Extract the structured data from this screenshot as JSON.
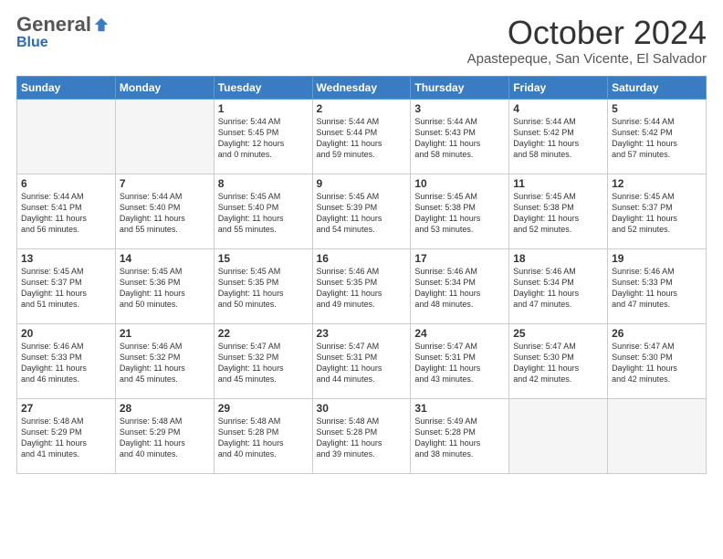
{
  "header": {
    "logo_general": "General",
    "logo_blue": "Blue",
    "month_title": "October 2024",
    "location": "Apastepeque, San Vicente, El Salvador"
  },
  "days_of_week": [
    "Sunday",
    "Monday",
    "Tuesday",
    "Wednesday",
    "Thursday",
    "Friday",
    "Saturday"
  ],
  "weeks": [
    [
      {
        "day": "",
        "info": ""
      },
      {
        "day": "",
        "info": ""
      },
      {
        "day": "1",
        "info": "Sunrise: 5:44 AM\nSunset: 5:45 PM\nDaylight: 12 hours\nand 0 minutes."
      },
      {
        "day": "2",
        "info": "Sunrise: 5:44 AM\nSunset: 5:44 PM\nDaylight: 11 hours\nand 59 minutes."
      },
      {
        "day": "3",
        "info": "Sunrise: 5:44 AM\nSunset: 5:43 PM\nDaylight: 11 hours\nand 58 minutes."
      },
      {
        "day": "4",
        "info": "Sunrise: 5:44 AM\nSunset: 5:42 PM\nDaylight: 11 hours\nand 58 minutes."
      },
      {
        "day": "5",
        "info": "Sunrise: 5:44 AM\nSunset: 5:42 PM\nDaylight: 11 hours\nand 57 minutes."
      }
    ],
    [
      {
        "day": "6",
        "info": "Sunrise: 5:44 AM\nSunset: 5:41 PM\nDaylight: 11 hours\nand 56 minutes."
      },
      {
        "day": "7",
        "info": "Sunrise: 5:44 AM\nSunset: 5:40 PM\nDaylight: 11 hours\nand 55 minutes."
      },
      {
        "day": "8",
        "info": "Sunrise: 5:45 AM\nSunset: 5:40 PM\nDaylight: 11 hours\nand 55 minutes."
      },
      {
        "day": "9",
        "info": "Sunrise: 5:45 AM\nSunset: 5:39 PM\nDaylight: 11 hours\nand 54 minutes."
      },
      {
        "day": "10",
        "info": "Sunrise: 5:45 AM\nSunset: 5:38 PM\nDaylight: 11 hours\nand 53 minutes."
      },
      {
        "day": "11",
        "info": "Sunrise: 5:45 AM\nSunset: 5:38 PM\nDaylight: 11 hours\nand 52 minutes."
      },
      {
        "day": "12",
        "info": "Sunrise: 5:45 AM\nSunset: 5:37 PM\nDaylight: 11 hours\nand 52 minutes."
      }
    ],
    [
      {
        "day": "13",
        "info": "Sunrise: 5:45 AM\nSunset: 5:37 PM\nDaylight: 11 hours\nand 51 minutes."
      },
      {
        "day": "14",
        "info": "Sunrise: 5:45 AM\nSunset: 5:36 PM\nDaylight: 11 hours\nand 50 minutes."
      },
      {
        "day": "15",
        "info": "Sunrise: 5:45 AM\nSunset: 5:35 PM\nDaylight: 11 hours\nand 50 minutes."
      },
      {
        "day": "16",
        "info": "Sunrise: 5:46 AM\nSunset: 5:35 PM\nDaylight: 11 hours\nand 49 minutes."
      },
      {
        "day": "17",
        "info": "Sunrise: 5:46 AM\nSunset: 5:34 PM\nDaylight: 11 hours\nand 48 minutes."
      },
      {
        "day": "18",
        "info": "Sunrise: 5:46 AM\nSunset: 5:34 PM\nDaylight: 11 hours\nand 47 minutes."
      },
      {
        "day": "19",
        "info": "Sunrise: 5:46 AM\nSunset: 5:33 PM\nDaylight: 11 hours\nand 47 minutes."
      }
    ],
    [
      {
        "day": "20",
        "info": "Sunrise: 5:46 AM\nSunset: 5:33 PM\nDaylight: 11 hours\nand 46 minutes."
      },
      {
        "day": "21",
        "info": "Sunrise: 5:46 AM\nSunset: 5:32 PM\nDaylight: 11 hours\nand 45 minutes."
      },
      {
        "day": "22",
        "info": "Sunrise: 5:47 AM\nSunset: 5:32 PM\nDaylight: 11 hours\nand 45 minutes."
      },
      {
        "day": "23",
        "info": "Sunrise: 5:47 AM\nSunset: 5:31 PM\nDaylight: 11 hours\nand 44 minutes."
      },
      {
        "day": "24",
        "info": "Sunrise: 5:47 AM\nSunset: 5:31 PM\nDaylight: 11 hours\nand 43 minutes."
      },
      {
        "day": "25",
        "info": "Sunrise: 5:47 AM\nSunset: 5:30 PM\nDaylight: 11 hours\nand 42 minutes."
      },
      {
        "day": "26",
        "info": "Sunrise: 5:47 AM\nSunset: 5:30 PM\nDaylight: 11 hours\nand 42 minutes."
      }
    ],
    [
      {
        "day": "27",
        "info": "Sunrise: 5:48 AM\nSunset: 5:29 PM\nDaylight: 11 hours\nand 41 minutes."
      },
      {
        "day": "28",
        "info": "Sunrise: 5:48 AM\nSunset: 5:29 PM\nDaylight: 11 hours\nand 40 minutes."
      },
      {
        "day": "29",
        "info": "Sunrise: 5:48 AM\nSunset: 5:28 PM\nDaylight: 11 hours\nand 40 minutes."
      },
      {
        "day": "30",
        "info": "Sunrise: 5:48 AM\nSunset: 5:28 PM\nDaylight: 11 hours\nand 39 minutes."
      },
      {
        "day": "31",
        "info": "Sunrise: 5:49 AM\nSunset: 5:28 PM\nDaylight: 11 hours\nand 38 minutes."
      },
      {
        "day": "",
        "info": ""
      },
      {
        "day": "",
        "info": ""
      }
    ]
  ]
}
